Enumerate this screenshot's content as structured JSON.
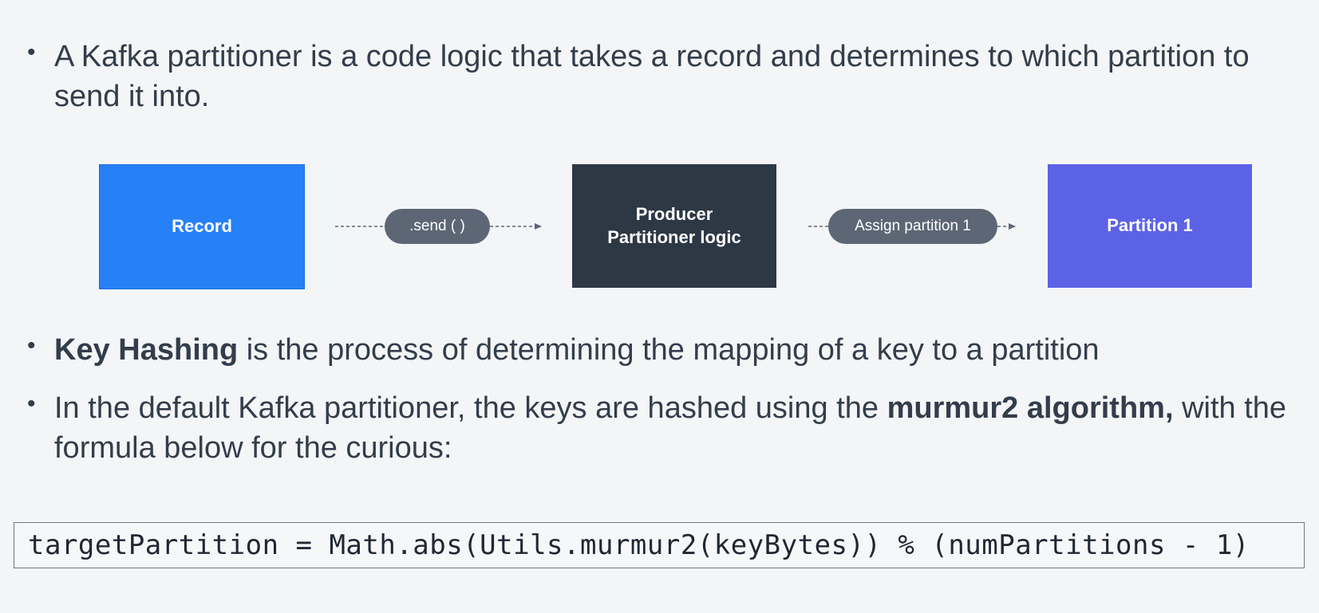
{
  "bullets": {
    "first": {
      "dot": "•",
      "text": "A Kafka partitioner is a code logic that takes a record and determines to which partition to send it into."
    },
    "second": {
      "dot": "•",
      "bold": "Key Hashing",
      "text": " is the process of determining the mapping of a key to a partition"
    },
    "third": {
      "dot": "•",
      "text_before": "In the default Kafka partitioner, the keys are hashed using the ",
      "bold": "murmur2 algorithm,",
      "text_after": " with the formula below for the curious:"
    }
  },
  "diagram": {
    "record_label": "Record",
    "send_label": ".send ( )",
    "producer_line1": "Producer",
    "producer_line2": "Partitioner logic",
    "assign_label": "Assign partition 1",
    "partition_label": "Partition 1",
    "colors": {
      "record": "#2680f6",
      "producer": "#2d3845",
      "partition": "#5b62e6",
      "pill": "#5c6675",
      "arrow": "#5c6675"
    }
  },
  "code": {
    "formula": "targetPartition = Math.abs(Utils.murmur2(keyBytes)) % (numPartitions - 1)"
  }
}
